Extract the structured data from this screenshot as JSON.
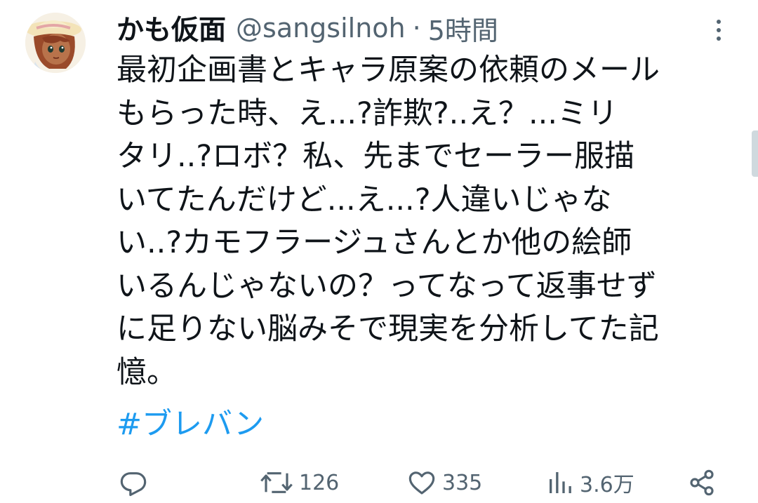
{
  "tweet": {
    "display_name": "かも仮面",
    "handle": "@sangsilnoh",
    "separator": "·",
    "time": "5時間",
    "text_lines": [
      "最初企画書とキャラ原案の依頼のメール",
      "もらった時、え...?詐欺?..え？...ミリ",
      "タリ..?ロボ？私、先までセーラー服描",
      "いてたんだけど...え...?人違いじゃな",
      "い..?カモフラージュさんとか他の絵師",
      "いるんじゃないの？ってなって返事せず",
      "に足りない脳みそで現実を分析してた記",
      "憶。"
    ],
    "hashtag": "#ブレバン"
  },
  "actions": {
    "reply": {
      "icon": "reply-icon",
      "count": ""
    },
    "retweet": {
      "icon": "retweet-icon",
      "count": "126"
    },
    "like": {
      "icon": "heart-icon",
      "count": "335"
    },
    "views": {
      "icon": "views-chart-icon",
      "count": "3.6万"
    },
    "share": {
      "icon": "share-icon"
    }
  },
  "colors": {
    "text": "#0f1419",
    "secondary": "#536471",
    "link": "#1d9bf0",
    "background": "#ffffff"
  }
}
